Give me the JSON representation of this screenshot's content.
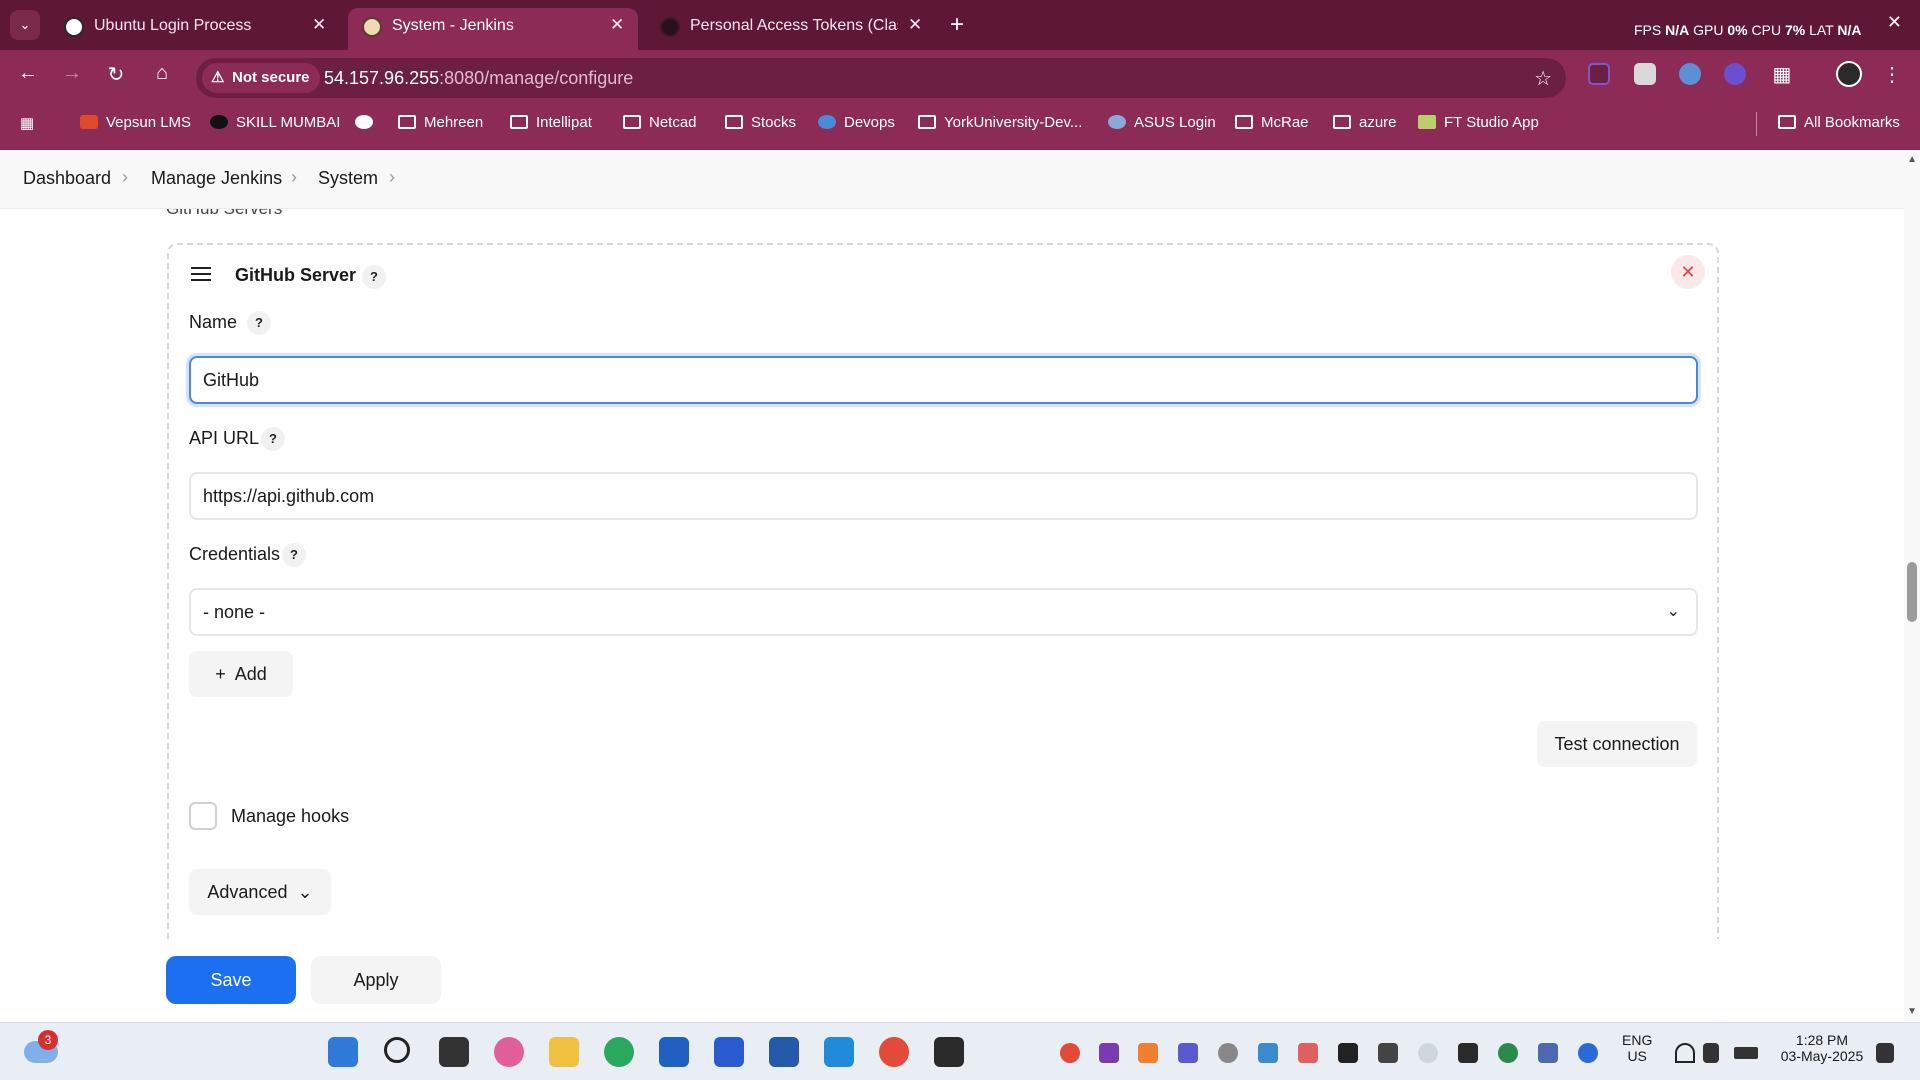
{
  "browser": {
    "tabs": [
      {
        "title": "Ubuntu Login Process",
        "icon": "chatgpt-icon",
        "active": false
      },
      {
        "title": "System - Jenkins",
        "icon": "jenkins-icon",
        "active": true
      },
      {
        "title": "Personal Access Tokens (Classic)",
        "icon": "github-icon",
        "active": false
      }
    ],
    "perf": {
      "fps_label": "FPS",
      "fps": "N/A",
      "gpu_label": "GPU",
      "gpu": "0%",
      "cpu_label": "CPU",
      "cpu": "7%",
      "lat_label": "LAT",
      "lat": "N/A"
    },
    "security_chip": "Not secure",
    "url_host": "54.157.96.255",
    "url_path": ":8080/manage/configure",
    "bookmarks": [
      {
        "label": "Vepsun LMS",
        "icon": "vepsun-icon"
      },
      {
        "label": "SKILL MUMBAI",
        "icon": "skill-mumbai-icon"
      },
      {
        "label": "",
        "icon": "globe-icon"
      },
      {
        "label": "Mehreen",
        "icon": "folder-icon"
      },
      {
        "label": "Intellipat",
        "icon": "folder-icon"
      },
      {
        "label": "Netcad",
        "icon": "folder-icon"
      },
      {
        "label": "Stocks",
        "icon": "folder-icon"
      },
      {
        "label": "Devops",
        "icon": "devops-icon"
      },
      {
        "label": "YorkUniversity-Dev...",
        "icon": "folder-icon"
      },
      {
        "label": "ASUS Login",
        "icon": "asus-icon"
      },
      {
        "label": "McRae",
        "icon": "folder-icon"
      },
      {
        "label": "azure",
        "icon": "folder-icon"
      },
      {
        "label": "FT Studio App",
        "icon": "ft-studio-icon"
      }
    ],
    "all_bookmarks": "All Bookmarks"
  },
  "breadcrumb": [
    "Dashboard",
    "Manage Jenkins",
    "System"
  ],
  "section_label": "GitHub Servers",
  "server": {
    "title": "GitHub Server",
    "name_label": "Name",
    "name_value": "GitHub",
    "api_url_label": "API URL",
    "api_url_value": "https://api.github.com",
    "credentials_label": "Credentials",
    "credentials_value": "- none -",
    "add_label": "Add",
    "test_connection_label": "Test connection",
    "manage_hooks_label": "Manage hooks",
    "manage_hooks_checked": false,
    "advanced_label": "Advanced"
  },
  "actions": {
    "save": "Save",
    "apply": "Apply"
  },
  "taskbar": {
    "weather_badge": "3",
    "lang_top": "ENG",
    "lang_bottom": "US",
    "time": "1:28 PM",
    "date": "03-May-2025"
  },
  "colors": {
    "chrome": "#8c2b56",
    "tabstrip": "#5e1836",
    "primary": "#1b6ff0",
    "danger": "#e04545"
  }
}
